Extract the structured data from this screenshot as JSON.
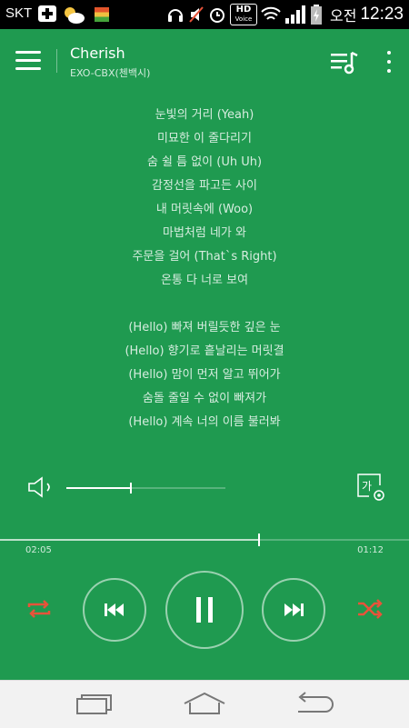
{
  "status_bar": {
    "carrier": "SKT",
    "hd_label": "HD",
    "hd_sub": "Voice",
    "ampm": "오전",
    "time": "12:23"
  },
  "player": {
    "title": "Cherish",
    "artist": "EXO-CBX(첸백시)",
    "lyrics_verse1": [
      "눈빛의 거리 (Yeah)",
      "미묘한 이 줄다리기",
      "숨 쉴 틈 없이 (Uh Uh)",
      "감정선을 파고든 사이",
      "내 머릿속에 (Woo)",
      "마법처럼 네가 와",
      "주문을 걸어 (That`s Right)",
      "온통 다 너로 보여"
    ],
    "lyrics_verse2": [
      "(Hello) 빠져 버릴듯한 깊은 눈",
      "(Hello) 향기로 흩날리는 머릿결",
      "(Hello) 맘이 먼저 알고 뛰어가",
      "숨돌 줄일 수 없이 빠져가",
      "(Hello) 계속 너의 이름 불러봐"
    ],
    "elapsed": "02:05",
    "total": "01:12",
    "seek_progress": 0.63,
    "volume_level": 0.4,
    "lyric_settings_glyph": "가",
    "accent_color": "#e8533a",
    "background_color": "#1f9a50"
  },
  "icons": {
    "menu": "hamburger-menu-icon",
    "playlist": "playlist-icon",
    "more": "more-vertical-icon",
    "volume": "speaker-icon",
    "lyric_settings": "lyric-settings-icon",
    "repeat": "repeat-icon",
    "prev": "skip-previous-icon",
    "pause": "pause-icon",
    "next": "skip-next-icon",
    "shuffle": "shuffle-icon",
    "nav_recent": "recent-apps-icon",
    "nav_home": "home-icon",
    "nav_back": "back-icon"
  }
}
